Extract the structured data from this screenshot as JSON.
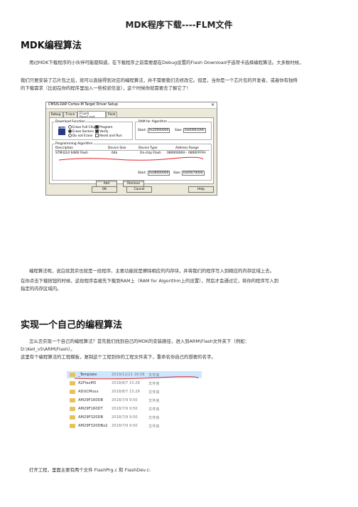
{
  "title": "MDK程序下载----FLM文件",
  "section1": {
    "heading": "MDK编程算法",
    "p1": "用过MDK下载程序的小伙伴可能都知道，在下载程序之前需要都在Debug设置的Flash Download子选项卡选择编程算法。大多数时候，",
    "p2": "我们只要安装了芯片包之后，就可以直接得到对应的编程算法，并不需要我们去修改它。但是，当你是一个芯片包的开发者，或者你有独特",
    "p3": "的下载需求（比如在你的程序里加入一些校验信息），这个时候你就需要去了解它了！"
  },
  "dialog": {
    "title": "CMSIS-DAP Cortex-M Target Driver Setup",
    "close": "×",
    "tabs": [
      "Debug",
      "Trace",
      "Flash Download",
      "Pack"
    ],
    "download_function": {
      "label": "Download Function",
      "icon_text": "LOAD",
      "options": [
        "Erase Full Chip",
        "Erase Sectors",
        "Do not Erase"
      ],
      "checks": [
        "Program",
        "Verify",
        "Reset and Run"
      ]
    },
    "ram": {
      "label": "RAM for Algorithm",
      "start_label": "Start:",
      "start": "0x20000000",
      "size_label": "Size:",
      "size": "0x00001000"
    },
    "programming": {
      "label": "Programming Algorithm",
      "columns": [
        "Description",
        "Device Size",
        "Device Type",
        "Address Range"
      ],
      "rows": [
        [
          "STM32L0 64KB Flash",
          "64k",
          "On-chip Flash",
          "08000000H - 0800FFFFH"
        ]
      ],
      "start_label": "Start:",
      "start": "0x08000000",
      "size_label": "Size:",
      "size": "0x00070000"
    },
    "buttons": {
      "add": "Add",
      "remove": "Remove",
      "ok": "OK",
      "cancel": "Cancel",
      "help": "Help"
    }
  },
  "section1_after": {
    "p1": "编程算法呢，说白就其实也就是一段程序，主要功能就是擦除相应的内存块，并将我们的程序写入到相应的内存区域上去。",
    "p2": "在你点击下载按钮的时候，这段程序会被先下载到RAM上（RAM for Algorithm上的设置），然后才会通过它，将你的程序写入到",
    "p3": "指定的内存区域内。"
  },
  "section2": {
    "heading": "实现一个自己的编程算法",
    "p1": "怎么去实现一个自己的编程算法？首先我们找到自己的MDK的安装路径，进入到ARM\\Flash文件夹下（例如：",
    "p2": "D:\\Keil_v5\\ARM\\Flash）。",
    "p3": "这里有个编程算法的工程模板，复制这个工程到你的工程文件夹下，重命名你自己的想要的名字。"
  },
  "explorer": {
    "rows": [
      {
        "name": "_Template",
        "date": "2019/11/21 16:58",
        "type": "文件夹"
      },
      {
        "name": "A2FlexM3",
        "date": "2018/8/7 15:26",
        "type": "文件夹"
      },
      {
        "name": "ADUCMxxx",
        "date": "2018/8/7 15:26",
        "type": "文件夹"
      },
      {
        "name": "AM29F160DB",
        "date": "2018/7/9 9:50",
        "type": "文件夹"
      },
      {
        "name": "AM29F160DT",
        "date": "2018/7/9 9:50",
        "type": "文件夹"
      },
      {
        "name": "AM29F320DB",
        "date": "2018/7/9 9:50",
        "type": "文件夹"
      },
      {
        "name": "AM29F320DBx2",
        "date": "2018/7/9 9:50",
        "type": "文件夹"
      }
    ]
  },
  "section2_after": {
    "p1": "打开工程，里面主要有两个文件 FlashPrg.c 和 FlashDev.c:"
  },
  "colors": {
    "annotation": "#e0242b"
  }
}
